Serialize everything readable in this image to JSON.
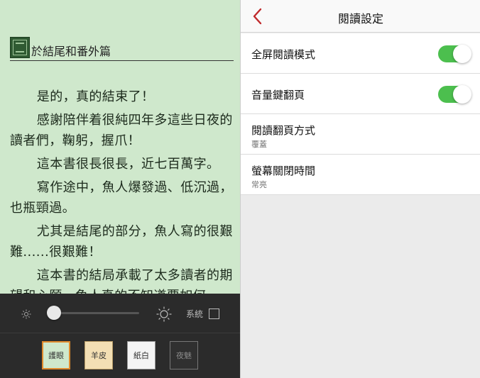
{
  "reader": {
    "chapter_title": "於結尾和番外篇",
    "paragraphs": [
      "是的，真的結束了！",
      "感謝陪伴着很純四年多這些日夜的讀者們，鞠躬，握爪！",
      "這本書很長很長，近七百萬字。",
      "寫作途中，魚人爆發過、低沉過，也瓶頸過。",
      "尤其是結尾的部分，魚人寫的很艱難......很艱難！",
      "這本書的結局承載了太多讀者的期望和心願，魚人真的不知道要如何"
    ]
  },
  "toolbar": {
    "brightness": 0.0,
    "system_label": "系統",
    "themes": [
      {
        "label": "護眼",
        "color": "#cfe8cc",
        "selected": true
      },
      {
        "label": "羊皮",
        "color": "#f3dfb4",
        "selected": false
      },
      {
        "label": "紙白",
        "color": "#f4f4f4",
        "selected": false
      },
      {
        "label": "夜魅",
        "color": "#303030",
        "selected": false
      }
    ],
    "icons": [
      "sun-small-icon",
      "sun-large-icon"
    ]
  },
  "settings": {
    "title": "閱讀設定",
    "back_icon": "chevron-left-icon",
    "accent_color": "#c0292b",
    "toggle_color": "#4cbf4e",
    "rows": [
      {
        "label": "全屏閱讀模式",
        "toggle": true
      },
      {
        "label": "音量鍵翻頁",
        "toggle": true
      },
      {
        "label": "閱讀翻頁方式",
        "value": "覆蓋"
      },
      {
        "label": "螢幕關閉時間",
        "value": "常亮"
      }
    ]
  }
}
